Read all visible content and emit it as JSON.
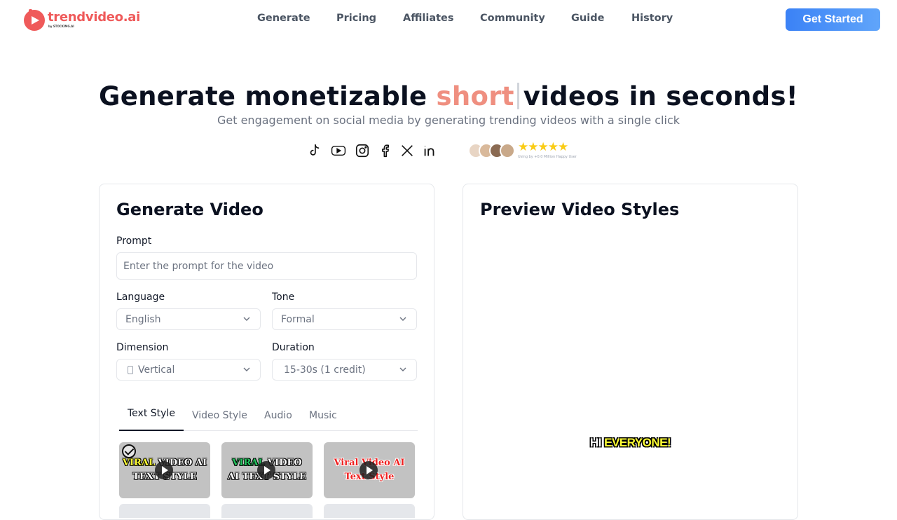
{
  "brand": {
    "name": "trendvideo.ai",
    "byline": "by STOCKIMG.AI",
    "color": "#ef5a5a"
  },
  "nav": [
    {
      "label": "Generate"
    },
    {
      "label": "Pricing"
    },
    {
      "label": "Affiliates"
    },
    {
      "label": "Community"
    },
    {
      "label": "Guide"
    },
    {
      "label": "History"
    }
  ],
  "cta": {
    "label": "Get Started",
    "color": "#3b82f6"
  },
  "hero": {
    "title_before": "Generate monetizable",
    "title_accent": "short",
    "title_after": "videos in seconds!",
    "accent_color": "#ef8f80",
    "subtitle": "Get engagement on social media by generating trending videos with a single click"
  },
  "social_icons": [
    "tiktok-icon",
    "youtube-icon",
    "instagram-icon",
    "facebook-icon",
    "x-icon",
    "linkedin-icon"
  ],
  "social_proof": {
    "stars": "★★★★★",
    "caption": "Using by +0.0 Million Happy User"
  },
  "generate": {
    "title": "Generate Video",
    "prompt_label": "Prompt",
    "prompt_placeholder": "Enter the prompt for the video",
    "prompt_value": "",
    "language_label": "Language",
    "language_value": "English",
    "tone_label": "Tone",
    "tone_value": "Formal",
    "dimension_label": "Dimension",
    "dimension_value": "Vertical",
    "duration_label": "Duration",
    "duration_value": "15-30s (1 credit)",
    "tabs": [
      {
        "label": "Text Style",
        "active": true
      },
      {
        "label": "Video Style",
        "active": false
      },
      {
        "label": "Audio",
        "active": false
      },
      {
        "label": "Music",
        "active": false
      }
    ],
    "styles": [
      {
        "line1a": "VIRAL",
        "line1b": " VIDEO AI",
        "line2": "TEXT STYLE",
        "selected": true
      },
      {
        "line1a": "VIRAL",
        "line1b": " VIDEO",
        "line2": "AI TEXT STYLE",
        "selected": false
      },
      {
        "line1a": "Viral",
        "line1b": " Video AI",
        "line2": "Text Style",
        "selected": false
      }
    ]
  },
  "preview": {
    "title": "Preview Video Styles",
    "caption_white": "HI ",
    "caption_yellow": "EVERYONE!"
  }
}
